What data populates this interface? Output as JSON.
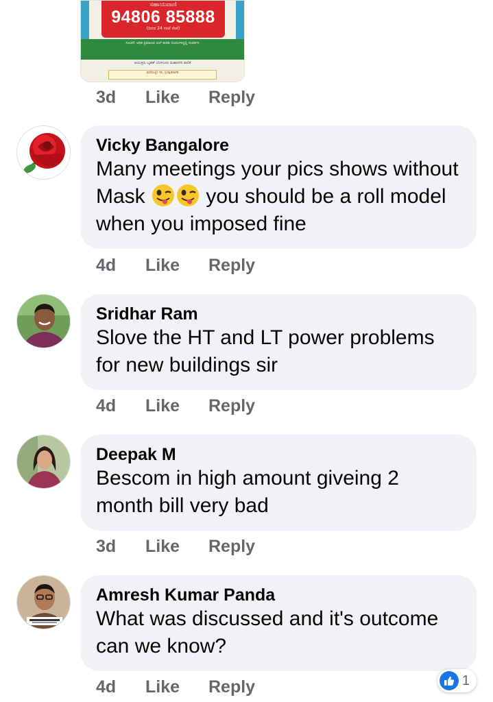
{
  "poster": {
    "helpline_label": "ಸಹಾಯವಾಣಿ",
    "phone_number": "94806 85888",
    "phone_sub": "(ದಿನದ 24 ಗಂಟೆ ಸೇವೆ)",
    "green_note": "ಸೂಚನೆ: ಅಧಿಕ ಪ್ರಮಾಣದ ಬಿಲ್‌ ಕುರಿತು ದೂರುಗಳಿದ್ದಲ್ಲಿ ಸಂಪರ್ಕಿಸಿ",
    "bottom_note": "ಆಯುಕ್ತರು ಬೃಹತ್ ಬೆಂಗಳೂರು ಮಹಾನಗರ ಪಾಲಿಕೆ",
    "slogan": "ಮನೆಯಲ್ಲೇ ಇರಿ, ಸುರಕ್ಷಿತವಾಗಿರಿ"
  },
  "first_actions": {
    "time": "3d",
    "like": "Like",
    "reply": "Reply"
  },
  "comments": [
    {
      "author": "Vicky Bangalore",
      "text_before_emoji": "Many meetings your pics shows without Mask",
      "emojis": [
        "winking-tongue-emoji",
        "winking-tongue-emoji"
      ],
      "text_after_emoji": "you should be a roll model when you imposed fine",
      "time": "4d",
      "like": "Like",
      "reply": "Reply"
    },
    {
      "author": "Sridhar Ram",
      "text": "Slove the HT and LT power problems for new buildings sir",
      "time": "4d",
      "like": "Like",
      "reply": "Reply"
    },
    {
      "author": "Deepak M",
      "text": "Bescom in high amount giveing 2 month bill very bad",
      "time": "3d",
      "like": "Like",
      "reply": "Reply"
    },
    {
      "author": "Amresh Kumar Panda",
      "text": "What was discussed and it's outcome can we know?",
      "time": "4d",
      "like": "Like",
      "reply": "Reply",
      "reaction_count": "1"
    }
  ],
  "colors": {
    "bubble": "#f0f2f5",
    "meta": "#65676b",
    "like_blue": "#1b74e4",
    "text": "#050505"
  }
}
